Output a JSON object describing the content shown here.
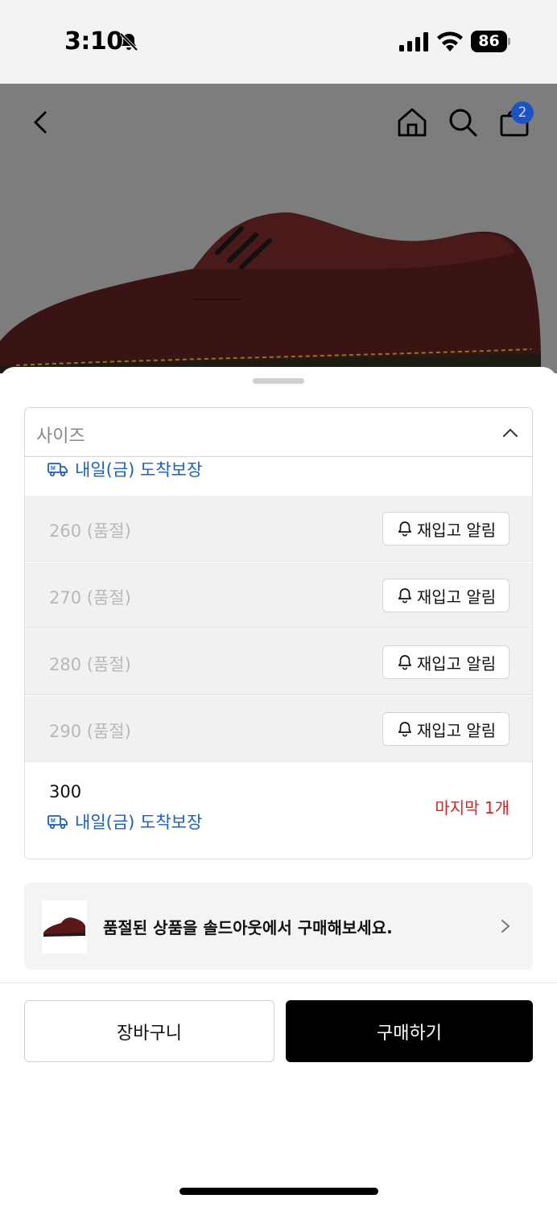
{
  "status_bar": {
    "time": "3:10",
    "battery": "86"
  },
  "header": {
    "cart_count": "2"
  },
  "size_selector": {
    "label": "사이즈"
  },
  "delivery_text": "내일(금) 도착보장",
  "sold_out_sizes": [
    {
      "label": "260 (품절)",
      "button": "재입고 알림"
    },
    {
      "label": "270 (품절)",
      "button": "재입고 알림"
    },
    {
      "label": "280 (품절)",
      "button": "재입고 알림"
    },
    {
      "label": "290 (품절)",
      "button": "재입고 알림"
    }
  ],
  "in_stock": {
    "size": "300",
    "delivery": "내일(금) 도착보장",
    "stock_note": "마지막 1개"
  },
  "soldout_banner": {
    "text": "품절된 상품을 솔드아웃에서 구매해보세요."
  },
  "actions": {
    "cart": "장바구니",
    "buy": "구매하기"
  },
  "colors": {
    "accent_blue": "#1a5fd0",
    "warning_red": "#dd2222",
    "buy_bg": "#000000"
  }
}
